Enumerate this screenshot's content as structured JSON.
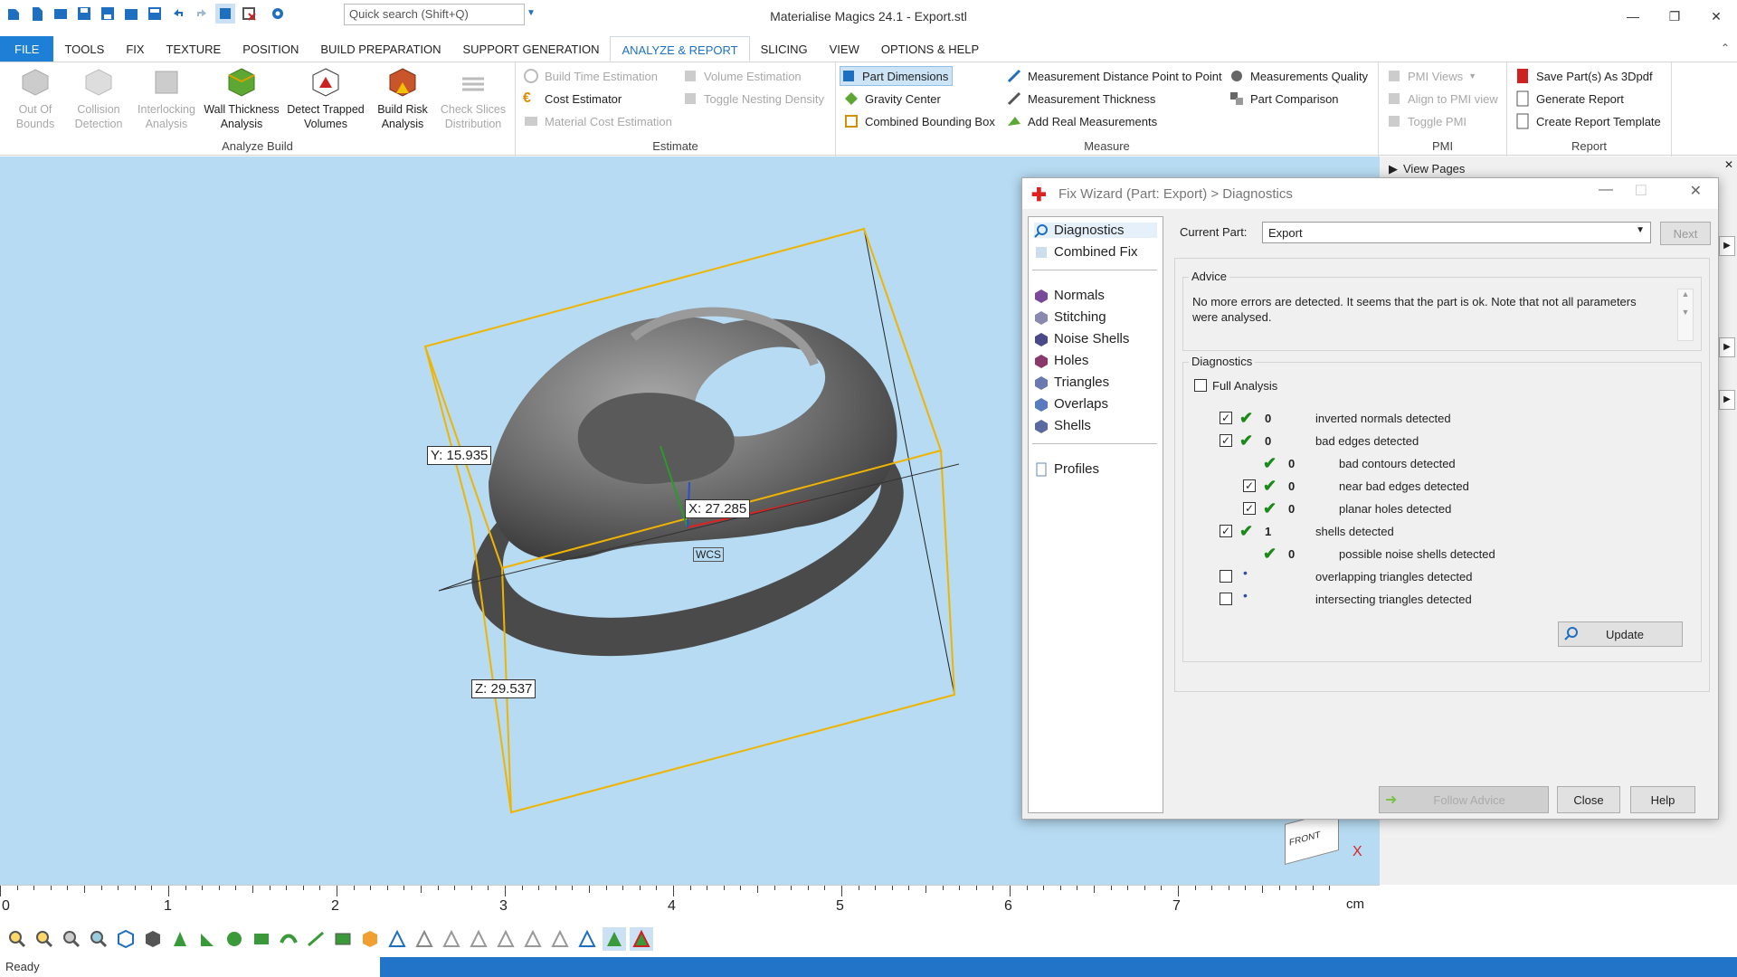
{
  "app": {
    "title": "Materialise Magics 24.1 - Export.stl",
    "search_placeholder": "Quick search (Shift+Q)"
  },
  "menu": [
    "FILE",
    "TOOLS",
    "FIX",
    "TEXTURE",
    "POSITION",
    "BUILD PREPARATION",
    "SUPPORT GENERATION",
    "ANALYZE & REPORT",
    "SLICING",
    "VIEW",
    "OPTIONS & HELP"
  ],
  "ribbon": {
    "analyze_build": {
      "label": "Analyze Build",
      "buttons": [
        {
          "l1": "Out Of",
          "l2": "Bounds"
        },
        {
          "l1": "Collision",
          "l2": "Detection"
        },
        {
          "l1": "Interlocking",
          "l2": "Analysis"
        },
        {
          "l1": "Wall Thickness",
          "l2": "Analysis"
        },
        {
          "l1": "Detect Trapped",
          "l2": "Volumes"
        },
        {
          "l1": "Build Risk",
          "l2": "Analysis"
        },
        {
          "l1": "Check Slices",
          "l2": "Distribution"
        }
      ]
    },
    "estimate": {
      "label": "Estimate",
      "items": [
        "Build Time Estimation",
        "Cost Estimator",
        "Material Cost Estimation",
        "Volume Estimation",
        "Toggle Nesting Density"
      ]
    },
    "measure": {
      "label": "Measure",
      "items": [
        "Part Dimensions",
        "Gravity Center",
        "Combined Bounding Box",
        "Measurement Distance Point to Point",
        "Measurement Thickness",
        "Add Real Measurements",
        "Measurements Quality",
        "Part Comparison"
      ]
    },
    "pmi": {
      "label": "PMI",
      "items": [
        "PMI Views",
        "Align to PMI view",
        "Toggle PMI"
      ]
    },
    "report": {
      "label": "Report",
      "items": [
        "Save Part(s) As 3Dpdf",
        "Generate Report",
        "Create Report Template"
      ]
    }
  },
  "viewport": {
    "dim_y": "Y: 15.935",
    "dim_x": "X: 27.285",
    "dim_z": "Z: 29.537",
    "wcs": "WCS",
    "front": "FRONT",
    "axis_x": "X"
  },
  "panel": {
    "view_pages": "View Pages"
  },
  "dialog": {
    "title": "Fix Wizard (Part: Export) > Diagnostics",
    "nav": [
      "Diagnostics",
      "Combined Fix",
      "Normals",
      "Stitching",
      "Noise Shells",
      "Holes",
      "Triangles",
      "Overlaps",
      "Shells",
      "Profiles"
    ],
    "current_part_label": "Current Part:",
    "current_part": "Export",
    "next": "Next",
    "advice_label": "Advice",
    "advice_text": "No more errors are detected. It seems that the part is ok. Note that not all parameters were analysed.",
    "diagnostics_label": "Diagnostics",
    "full_analysis": "Full Analysis",
    "rows": [
      {
        "count": "0",
        "text": "inverted normals detected"
      },
      {
        "count": "0",
        "text": "bad edges detected"
      },
      {
        "count": "0",
        "text": "bad contours detected"
      },
      {
        "count": "0",
        "text": "near bad edges detected"
      },
      {
        "count": "0",
        "text": "planar holes detected"
      },
      {
        "count": "1",
        "text": "shells detected"
      },
      {
        "count": "0",
        "text": "possible noise shells detected"
      },
      {
        "count": "",
        "text": "overlapping triangles detected"
      },
      {
        "count": "",
        "text": "intersecting triangles detected"
      }
    ],
    "update": "Update",
    "follow_advice": "Follow Advice",
    "close": "Close",
    "help": "Help"
  },
  "ruler": {
    "labels": [
      "0",
      "1",
      "2",
      "3",
      "4",
      "5",
      "6",
      "7"
    ],
    "unit": "cm"
  },
  "status": "Ready"
}
